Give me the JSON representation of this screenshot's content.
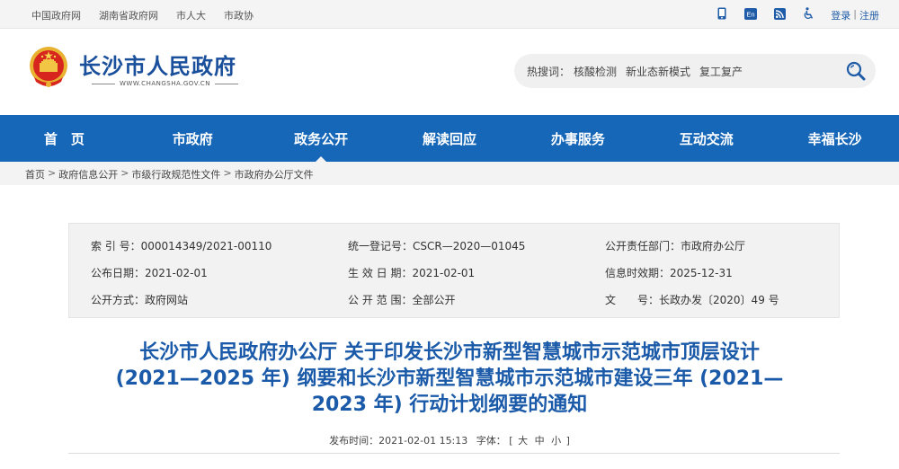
{
  "topbar": {
    "links": [
      "中国政府网",
      "湖南省政府网",
      "市人大",
      "市政协"
    ],
    "icons": [
      "mobile-icon",
      "english-icon",
      "rss-icon",
      "accessibility-icon"
    ],
    "english_text": "En",
    "login": "登录",
    "separator": "|",
    "register": "注册"
  },
  "header": {
    "site_title": "长沙市人民政府",
    "site_url": "WWW.CHANGSHA.GOV.CN",
    "search": {
      "hot_label": "热搜词：",
      "hot_links": [
        "核酸检测",
        "新业态新模式",
        "复工复产"
      ]
    }
  },
  "nav": {
    "items": [
      "首　页",
      "市政府",
      "政务公开",
      "解读回应",
      "办事服务",
      "互动交流",
      "幸福长沙"
    ],
    "active_index": 2
  },
  "breadcrumb": {
    "items": [
      "首页",
      "政府信息公开",
      "市级行政规范性文件",
      "市政府办公厅文件"
    ],
    "separator": ">"
  },
  "info": {
    "rows": [
      [
        {
          "label": "索 引 号：",
          "value": "000014349/2021-00110"
        },
        {
          "label": "统一登记号：",
          "value": "CSCR—2020—01045"
        },
        {
          "label": "公开责任部门：",
          "value": "市政府办公厅"
        }
      ],
      [
        {
          "label": "公布日期：",
          "value": "2021-02-01"
        },
        {
          "label": "生 效 日 期：",
          "value": "2021-02-01"
        },
        {
          "label": "信息时效期：",
          "value": "2025-12-31"
        }
      ],
      [
        {
          "label": "公开方式：",
          "value": "政府网站"
        },
        {
          "label": "公 开 范 围：",
          "value": "全部公开"
        },
        {
          "label": "文　　号：",
          "value": "长政办发〔2020〕49 号"
        }
      ]
    ]
  },
  "document": {
    "title_lines": [
      "长沙市人民政府办公厅 关于印发长沙市新型智慧城市示范城市顶层设计",
      "(2021—2025 年) 纲要和长沙市新型智慧城市示范城市建设三年 (2021—",
      "2023 年) 行动计划纲要的通知"
    ],
    "meta": {
      "publish_label": "发布时间：",
      "publish_time": "2021-02-01 15:13",
      "font_label": "字体：",
      "bracket_open": "[",
      "font_large": "大",
      "font_medium": "中",
      "font_small": "小",
      "bracket_close": "]"
    }
  },
  "colors": {
    "nav_blue": "#1667b8",
    "title_blue": "#1a5aa8",
    "site_title_blue": "#1a4f9c"
  }
}
